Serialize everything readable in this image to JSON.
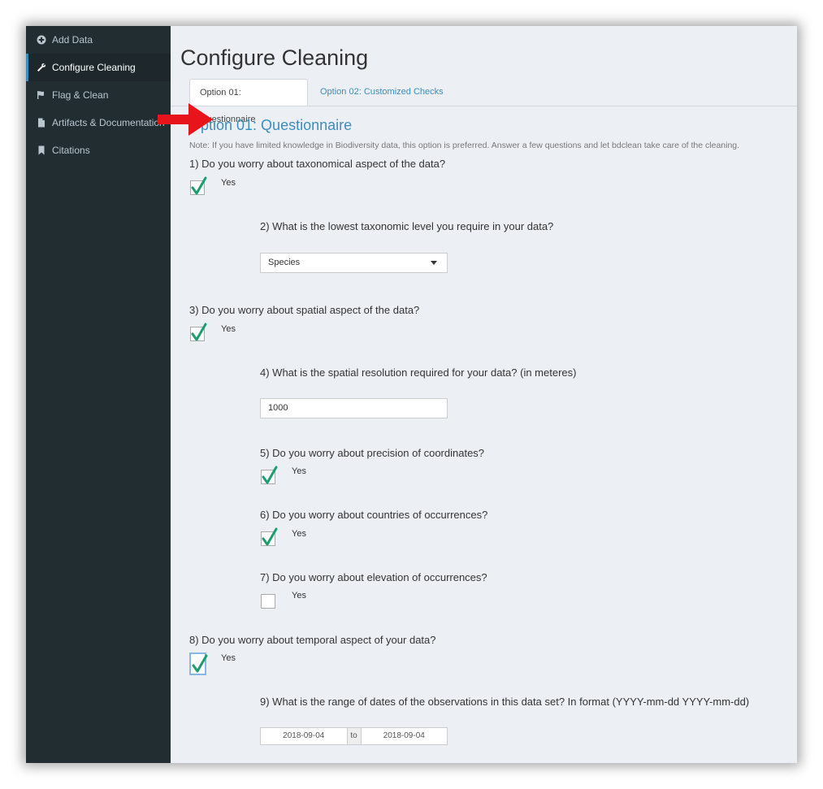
{
  "sidebar": {
    "items": [
      {
        "label": "Add Data",
        "icon": "plus-circle-icon"
      },
      {
        "label": "Configure Cleaning",
        "icon": "wrench-icon",
        "active": true
      },
      {
        "label": "Flag & Clean",
        "icon": "flag-icon"
      },
      {
        "label": "Artifacts & Documentation",
        "icon": "file-icon"
      },
      {
        "label": "Citations",
        "icon": "bookmark-icon"
      }
    ]
  },
  "page": {
    "title": "Configure Cleaning"
  },
  "tabs": [
    {
      "label": "Option 01: Questionnaire",
      "active": true
    },
    {
      "label": "Option 02: Customized Checks",
      "active": false
    }
  ],
  "questionnaire": {
    "heading": "Option 01: Questionnaire",
    "note": "Note: If you have limited knowledge in Biodiversity data, this option is preferred. Answer a few questions and let bdclean take care of the cleaning.",
    "yes_label": "Yes",
    "q1": {
      "text": "1) Do you worry about taxonomical aspect of the data?",
      "checked": true
    },
    "q2": {
      "text": "2) What is the lowest taxonomic level you require in your data?",
      "selected": "Species"
    },
    "q3": {
      "text": "3) Do you worry about spatial aspect of the data?",
      "checked": true
    },
    "q4": {
      "text": "4) What is the spatial resolution required for your data? (in meteres)",
      "value": "1000"
    },
    "q5": {
      "text": "5) Do you worry about precision of coordinates?",
      "checked": true
    },
    "q6": {
      "text": "6) Do you worry about countries of occurrences?",
      "checked": true
    },
    "q7": {
      "text": "7) Do you worry about elevation of occurrences?",
      "checked": false
    },
    "q8": {
      "text": "8) Do you worry about temporal aspect of your data?",
      "checked": true
    },
    "q9": {
      "text": "9) What is the range of dates of the observations in this data set? In format (YYYY-mm-dd YYYY-mm-dd)",
      "start": "2018-09-04",
      "separator": "to",
      "end": "2018-09-04"
    }
  },
  "colors": {
    "sidebar_bg": "#222d32",
    "accent": "#3c8dbc",
    "check": "#1a9e6e",
    "arrow": "#e8141b"
  }
}
